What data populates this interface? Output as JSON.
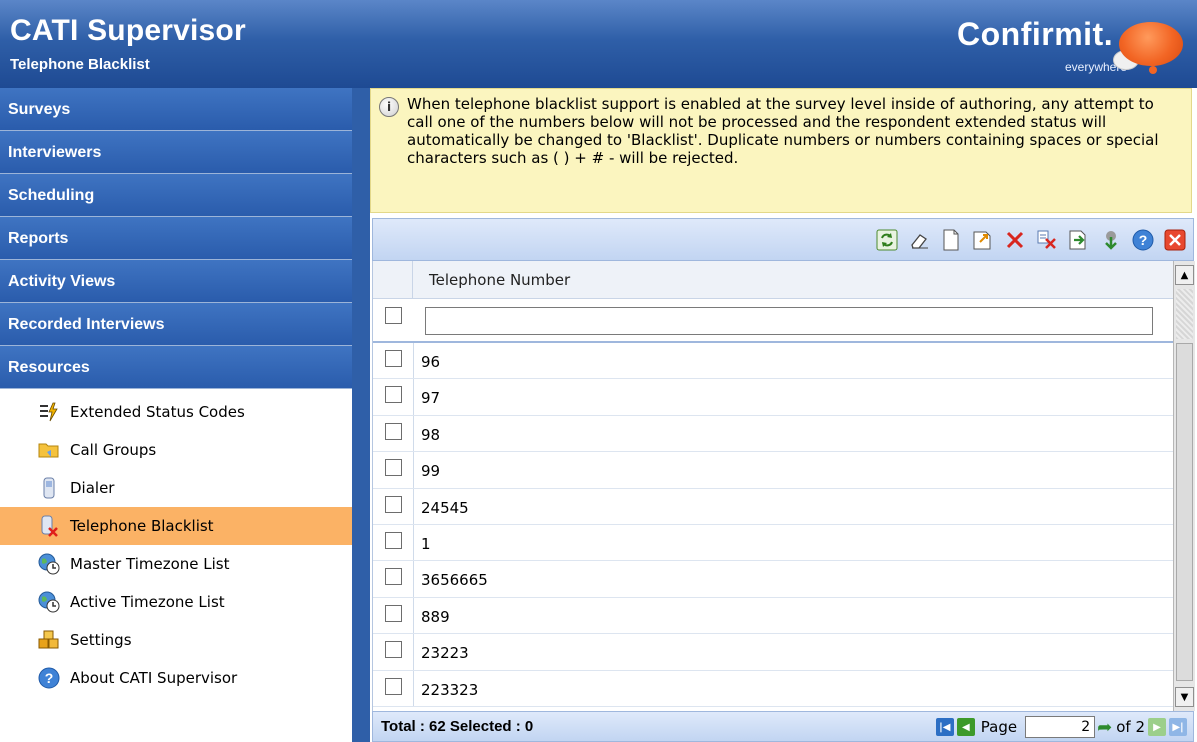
{
  "header": {
    "title": "CATI Supervisor",
    "subtitle": "Telephone Blacklist",
    "logo_text": "Confirmit.",
    "logo_tagline": "everywhere"
  },
  "sidebar": {
    "sections": [
      {
        "label": "Surveys"
      },
      {
        "label": "Interviewers"
      },
      {
        "label": "Scheduling"
      },
      {
        "label": "Reports"
      },
      {
        "label": "Activity Views"
      },
      {
        "label": "Recorded Interviews"
      },
      {
        "label": "Resources"
      }
    ],
    "resources": [
      {
        "label": "Extended Status Codes",
        "icon": "status-codes-icon",
        "active": false
      },
      {
        "label": "Call Groups",
        "icon": "folder-icon",
        "active": false
      },
      {
        "label": "Dialer",
        "icon": "phone-icon",
        "active": false
      },
      {
        "label": "Telephone Blacklist",
        "icon": "blacklist-phone-icon",
        "active": true
      },
      {
        "label": "Master Timezone List",
        "icon": "globe-clock-icon",
        "active": false
      },
      {
        "label": "Active Timezone List",
        "icon": "globe-clock-icon",
        "active": false
      },
      {
        "label": "Settings",
        "icon": "settings-icon",
        "active": false
      },
      {
        "label": "About CATI Supervisor",
        "icon": "help-icon",
        "active": false
      }
    ]
  },
  "info": {
    "text": "When telephone blacklist support is enabled at the survey level inside of authoring, any attempt to call one of the numbers below will not be processed and the respondent extended status will automatically be changed to 'Blacklist'. Duplicate numbers or numbers containing spaces or special characters such as ( ) + # - will be rejected."
  },
  "toolbar": {
    "buttons": [
      "refresh-icon",
      "eraser-icon",
      "new-icon",
      "open-icon",
      "delete-icon",
      "delete-all-icon",
      "export-icon",
      "import-icon",
      "help-icon",
      "close-icon"
    ]
  },
  "grid": {
    "column_header": "Telephone Number",
    "filter_value": "",
    "rows": [
      "96",
      "97",
      "98",
      "99",
      "24545",
      "1",
      "3656665",
      "889",
      "23223",
      "223323"
    ]
  },
  "footer": {
    "total_text": "Total : 62 Selected : 0",
    "page_label": "Page",
    "page_value": "2",
    "of_text": "of 2"
  }
}
